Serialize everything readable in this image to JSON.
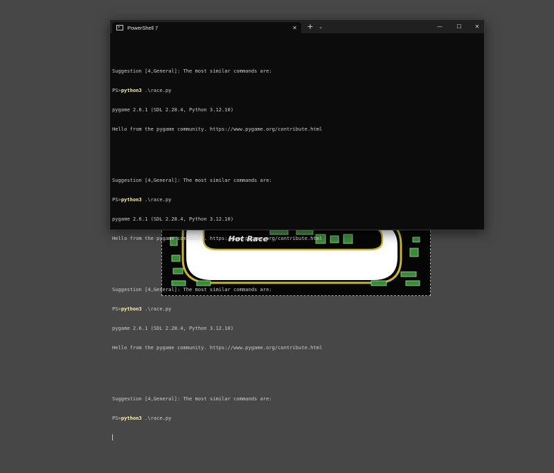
{
  "game": {
    "title": "Hot Race",
    "colors": {
      "track_edge": "#c8b43a",
      "track": "#ffffff",
      "block": "#3a8a3a",
      "background": "#060606"
    }
  },
  "terminal": {
    "tab": {
      "icon": "powershell-icon",
      "title": "PowerShell 7",
      "close": "✕"
    },
    "new_tab": "+",
    "dropdown": "⌄",
    "window_controls": {
      "minimize": "—",
      "maximize": "☐",
      "close": "✕"
    },
    "prompt": "PS>",
    "blocks": [
      {
        "suggestion": "Suggestion [4,General]: The most similar commands are:",
        "command": "python3",
        "args": " .\\race.py",
        "output": [
          "pygame 2.6.1 (SDL 2.28.4, Python 3.12.10)",
          "Hello from the pygame community. https://www.pygame.org/contribute.html"
        ]
      },
      {
        "suggestion": "Suggestion [4,General]: The most similar commands are:",
        "command": "python3",
        "args": " .\\race.py",
        "output": [
          "pygame 2.6.1 (SDL 2.28.4, Python 3.12.10)",
          "Hello from the pygame community. https://www.pygame.org/contribute.html"
        ]
      },
      {
        "suggestion": "Suggestion [4,General]: The most similar commands are:",
        "command": "python3",
        "args": " .\\race.py",
        "output": [
          "pygame 2.6.1 (SDL 2.28.4, Python 3.12.10)",
          "Hello from the pygame community. https://www.pygame.org/contribute.html"
        ]
      },
      {
        "suggestion": "Suggestion [4,General]: The most similar commands are:",
        "command": "python3",
        "args": " .\\race.py",
        "output": []
      }
    ],
    "colors": {
      "background": "#0c0c0c",
      "text": "#cccccc",
      "command": "#f9f1a5",
      "titlebar": "#202020"
    }
  }
}
